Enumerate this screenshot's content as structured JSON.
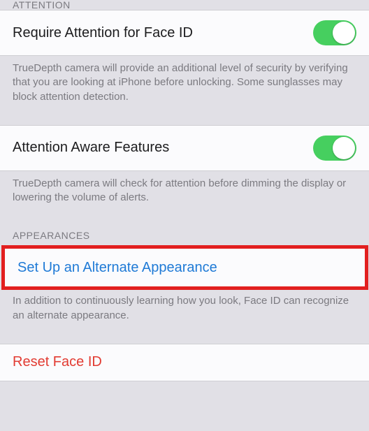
{
  "sections": {
    "attention": {
      "header": "ATTENTION",
      "rows": {
        "require_attention": {
          "label": "Require Attention for Face ID",
          "toggle": true,
          "footer": "TrueDepth camera will provide an additional level of security by verifying that you are looking at iPhone before unlocking. Some sunglasses may block attention detection."
        },
        "attention_aware": {
          "label": "Attention Aware Features",
          "toggle": true,
          "footer": "TrueDepth camera will check for attention before dimming the display or lowering the volume of alerts."
        }
      }
    },
    "appearances": {
      "header": "APPEARANCES",
      "rows": {
        "alternate": {
          "label": "Set Up an Alternate Appearance",
          "footer": "In addition to continuously learning how you look, Face ID can recognize an alternate appearance."
        },
        "reset": {
          "label": "Reset Face ID"
        }
      }
    }
  }
}
